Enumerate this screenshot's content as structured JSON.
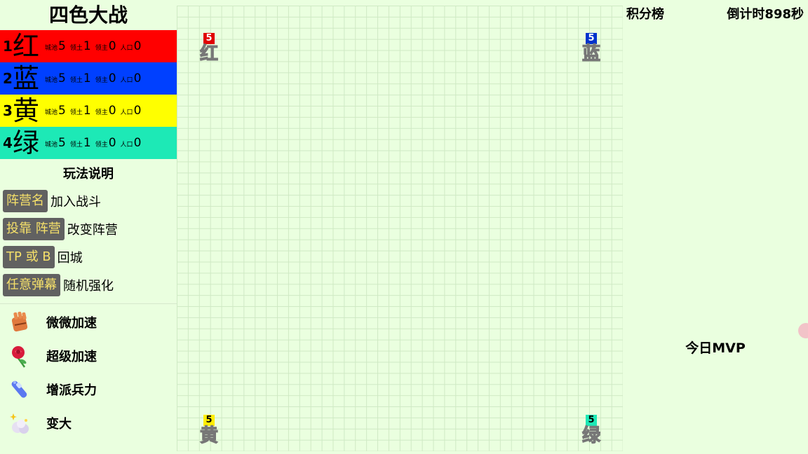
{
  "game": {
    "title": "四色大战"
  },
  "teams": [
    {
      "rank": "1",
      "name": "红",
      "color": "#ff0000",
      "stats": [
        {
          "label": "城池",
          "value": "5"
        },
        {
          "label": "领土",
          "value": "1"
        },
        {
          "label": "领主",
          "value": "0"
        },
        {
          "label": "人口",
          "value": "0"
        }
      ]
    },
    {
      "rank": "2",
      "name": "蓝",
      "color": "#0040ff",
      "stats": [
        {
          "label": "城池",
          "value": "5"
        },
        {
          "label": "领土",
          "value": "1"
        },
        {
          "label": "领主",
          "value": "0"
        },
        {
          "label": "人口",
          "value": "0"
        }
      ]
    },
    {
      "rank": "3",
      "name": "黄",
      "color": "#ffff00",
      "stats": [
        {
          "label": "城池",
          "value": "5"
        },
        {
          "label": "领土",
          "value": "1"
        },
        {
          "label": "领主",
          "value": "0"
        },
        {
          "label": "人口",
          "value": "0"
        }
      ]
    },
    {
      "rank": "4",
      "name": "绿",
      "color": "#1de9b6",
      "stats": [
        {
          "label": "城池",
          "value": "5"
        },
        {
          "label": "领土",
          "value": "1"
        },
        {
          "label": "领主",
          "value": "0"
        },
        {
          "label": "人口",
          "value": "0"
        }
      ]
    }
  ],
  "rules": {
    "title": "玩法说明",
    "items": [
      {
        "cmd": "阵营名",
        "desc": "加入战斗"
      },
      {
        "cmd": "投靠 阵营",
        "desc": "改变阵营"
      },
      {
        "cmd": "TP 或 B",
        "desc": "回城"
      },
      {
        "cmd": "任意弹幕",
        "desc": "随机强化"
      }
    ]
  },
  "gifts": [
    {
      "icon": "glove-gift-icon",
      "name": "微微加速"
    },
    {
      "icon": "rose-gift-icon",
      "name": "超级加速"
    },
    {
      "icon": "wand-gift-icon",
      "name": "增派兵力"
    },
    {
      "icon": "sparkle-gift-icon",
      "name": "变大"
    }
  ],
  "board": {
    "bases": [
      {
        "team": "红",
        "count": "5",
        "color": "#e00000"
      },
      {
        "team": "蓝",
        "count": "5",
        "color": "#0033cc"
      },
      {
        "team": "黄",
        "count": "5",
        "color": "#ffee00"
      },
      {
        "team": "绿",
        "count": "5",
        "color": "#1de9b6"
      }
    ]
  },
  "leaderboard": {
    "title": "积分榜",
    "countdown": "倒计时898秒"
  },
  "mvp": {
    "title": "今日MVP"
  }
}
